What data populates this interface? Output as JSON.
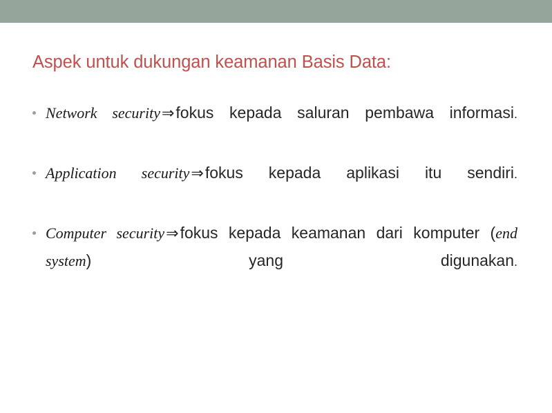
{
  "slide": {
    "title": "Aspek untuk dukungan keamanan Basis Data:",
    "title_color": "#c0504d",
    "band_color": "#93a699",
    "body_color": "#262626",
    "bullet_marker_color": "#9d9d9d",
    "arrow_glyph": "⇒",
    "bullets": [
      {
        "term": "Network security",
        "arrow": "⇒",
        "text": "fokus kepada saluran pembawa informasi",
        "end_punct": "."
      },
      {
        "term": "Application security",
        "arrow": "⇒",
        "text": "fokus kepada aplikasi itu sendiri",
        "end_punct": "."
      },
      {
        "term": "Computer security",
        "arrow": "⇒",
        "text_before": "fokus kepada keamanan dari komputer (",
        "inline_term": "end system",
        "text_after": ") yang digunakan",
        "end_punct": "."
      }
    ]
  }
}
